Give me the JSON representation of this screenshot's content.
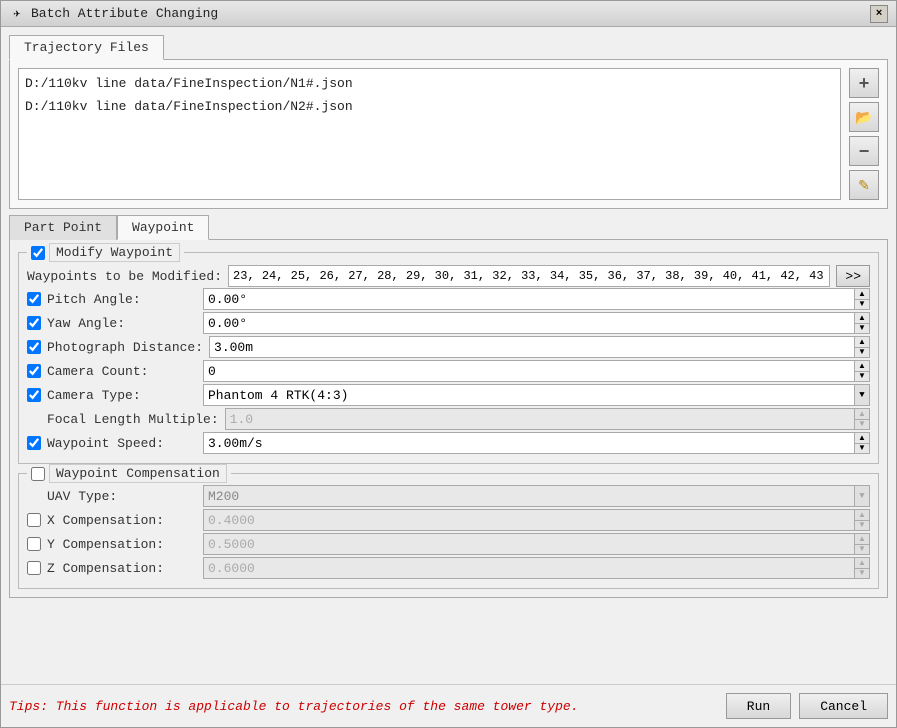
{
  "window": {
    "title": "Batch Attribute Changing",
    "close_label": "×"
  },
  "trajectory_tab": {
    "label": "Trajectory Files",
    "files": [
      "D:/110kv line data/FineInspection/N1#.json",
      "D:/110kv line data/FineInspection/N2#.json"
    ]
  },
  "sidebar_buttons": {
    "add": "+",
    "folder": "📁",
    "remove": "−",
    "edit": "✎"
  },
  "bottom_tabs": {
    "part_point": "Part Point",
    "waypoint": "Waypoint"
  },
  "modify_waypoint": {
    "section_label": "Modify Waypoint",
    "waypoints_label": "Waypoints to be Modified:",
    "waypoints_value": "23, 24, 25, 26, 27, 28, 29, 30, 31, 32, 33, 34, 35, 36, 37, 38, 39, 40, 41, 42, 43,",
    "expand_btn": ">>",
    "pitch_label": "Pitch Angle:",
    "pitch_value": "0.00°",
    "yaw_label": "Yaw Angle:",
    "yaw_value": "0.00°",
    "photo_dist_label": "Photograph Distance:",
    "photo_dist_value": "3.00m",
    "camera_count_label": "Camera Count:",
    "camera_count_value": "0",
    "camera_type_label": "Camera Type:",
    "camera_type_value": "Phantom 4 RTK(4:3)",
    "focal_length_label": "Focal Length Multiple:",
    "focal_length_value": "1.0",
    "waypoint_speed_label": "Waypoint Speed:",
    "waypoint_speed_value": "3.00m/s"
  },
  "waypoint_compensation": {
    "section_label": "Waypoint Compensation",
    "uav_type_label": "UAV Type:",
    "uav_type_value": "M200",
    "x_comp_label": "X Compensation:",
    "x_comp_value": "0.4000",
    "y_comp_label": "Y Compensation:",
    "y_comp_value": "0.5000",
    "z_comp_label": "Z Compensation:",
    "z_comp_value": "0.6000"
  },
  "bottom": {
    "tips": "Tips: This function is applicable to trajectories of the same tower type.",
    "run_label": "Run",
    "cancel_label": "Cancel"
  }
}
